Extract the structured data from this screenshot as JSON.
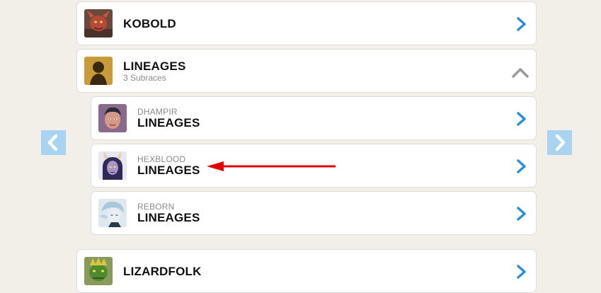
{
  "races": [
    {
      "name": "KOBOLD"
    },
    {
      "name": "LINEAGES",
      "subtitle": "3 Subraces"
    },
    {
      "name": "LIZARDFOLK"
    }
  ],
  "subraces": [
    {
      "overline": "DHAMPIR",
      "name": "LINEAGES"
    },
    {
      "overline": "HEXBLOOD",
      "name": "LINEAGES"
    },
    {
      "overline": "REBORN",
      "name": "LINEAGES"
    }
  ],
  "colors": {
    "accent": "#2e8fd8",
    "nav_button": "#a8d4f2",
    "annotation_arrow": "#e00000",
    "collapse_chevron": "#9a9a9a"
  },
  "icons": {
    "expand": "chevron-right-icon",
    "collapse": "chevron-up-icon",
    "prev": "chevron-left-icon",
    "next": "chevron-right-icon"
  }
}
